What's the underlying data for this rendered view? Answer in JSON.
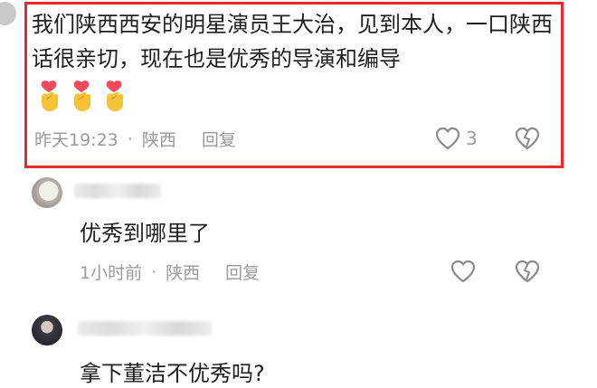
{
  "main_comment": {
    "text": "我们陕西西安的明星演员王大治，见到本人，一口陕西话很亲切，现在也是优秀的导演和编导",
    "emojis": [
      "finger-heart-emoji",
      "finger-heart-emoji",
      "finger-heart-emoji"
    ],
    "time": "昨天19:23",
    "separator": "·",
    "location": "陕西",
    "reply_label": "回复",
    "like_count": "3"
  },
  "replies": [
    {
      "text": "优秀到哪里了",
      "time": "1小时前",
      "separator": "·",
      "location": "陕西",
      "reply_label": "回复"
    },
    {
      "text": "拿下董洁不优秀吗?"
    }
  ],
  "colors": {
    "highlight_border": "#e8292f",
    "meta_text": "#9a9a9a",
    "body_text": "#1f1f1f"
  }
}
